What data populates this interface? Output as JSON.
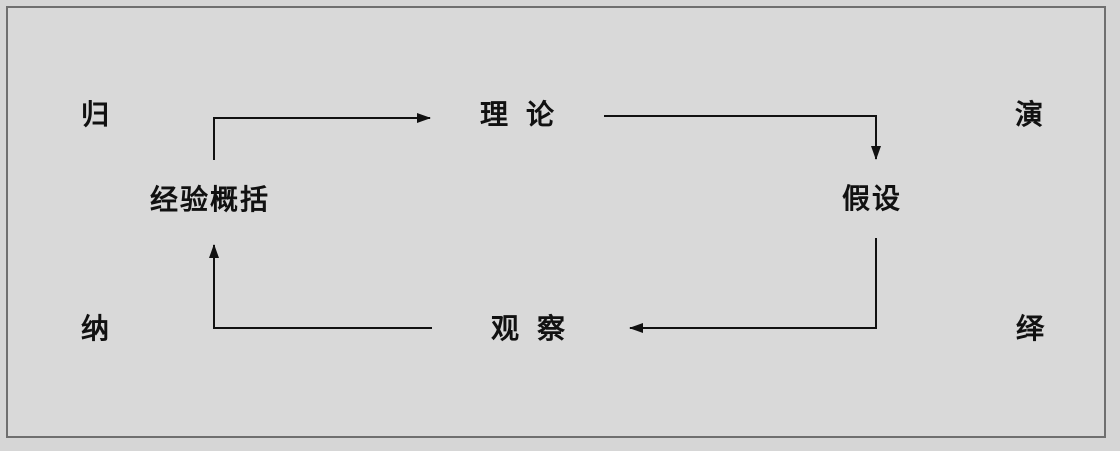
{
  "diagram": {
    "nodes": {
      "theory": "理论",
      "hypothesis": "假设",
      "observation": "观察",
      "generalization": "经验概括"
    },
    "side_labels": {
      "induction_top": "归",
      "induction_bottom": "纳",
      "deduction_top": "演",
      "deduction_bottom": "绎"
    },
    "edges": [
      {
        "from": "generalization",
        "to": "theory"
      },
      {
        "from": "theory",
        "to": "hypothesis"
      },
      {
        "from": "hypothesis",
        "to": "observation"
      },
      {
        "from": "observation",
        "to": "generalization"
      }
    ]
  }
}
